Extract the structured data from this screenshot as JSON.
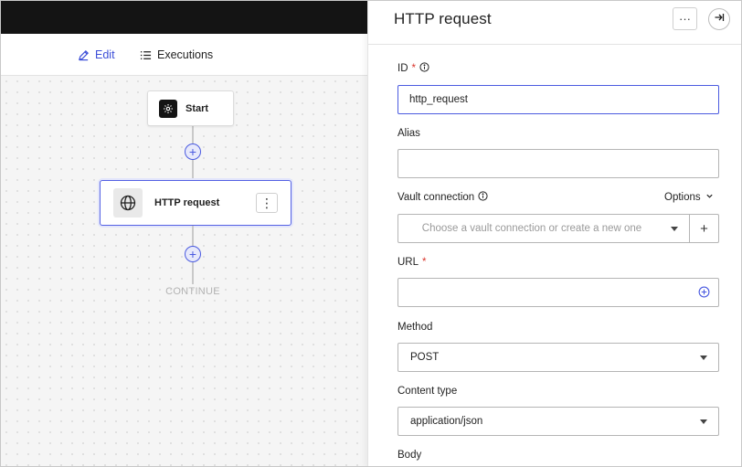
{
  "subnav": {
    "edit_label": "Edit",
    "executions_label": "Executions",
    "active_color": "#3d4fd8"
  },
  "canvas": {
    "start_node_label": "Start",
    "http_node_label": "HTTP request",
    "continue_label": "CONTINUE",
    "selected_color": "#5562e3"
  },
  "panel": {
    "title": "HTTP request",
    "more_label": "···",
    "fields": {
      "id": {
        "label": "ID",
        "required_mark": "*",
        "value": "http_request"
      },
      "alias": {
        "label": "Alias",
        "value": ""
      },
      "vault": {
        "label": "Vault connection",
        "options_label": "Options",
        "placeholder": "Choose a vault connection or create a new one",
        "add_label": "+"
      },
      "url": {
        "label": "URL",
        "required_mark": "*",
        "value": ""
      },
      "method": {
        "label": "Method",
        "value": "POST"
      },
      "content_type": {
        "label": "Content type",
        "value": "application/json"
      },
      "body": {
        "label": "Body"
      }
    }
  }
}
